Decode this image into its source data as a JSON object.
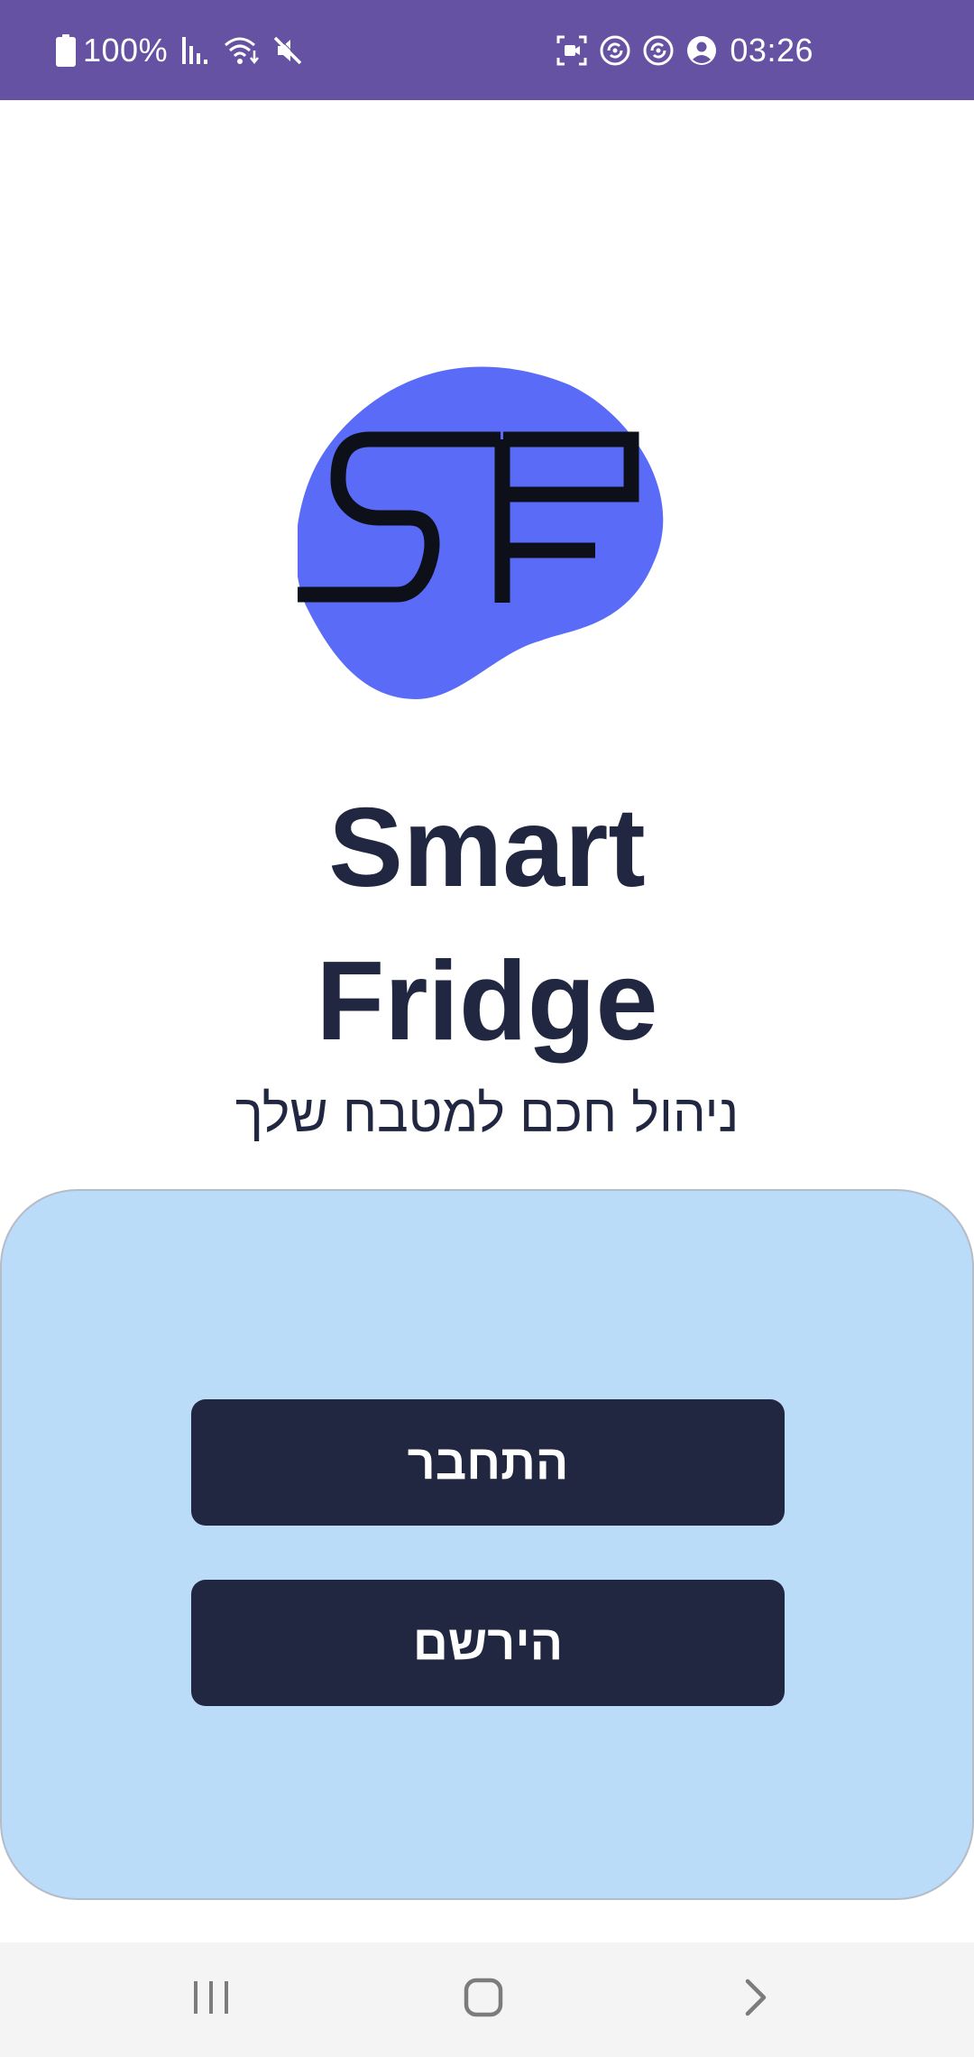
{
  "status_bar": {
    "battery": "100%",
    "time": "03:26",
    "background": "#6652a3",
    "icons_left": [
      "battery-icon",
      "signal-icon",
      "wifi-icon",
      "mute-icon"
    ],
    "icons_right": [
      "screen-record-icon",
      "sync-icon",
      "sync-icon",
      "account-icon"
    ]
  },
  "logo": {
    "text": "SF",
    "blob_color": "#5a6cf7"
  },
  "app": {
    "title_line1": "Smart",
    "title_line2": "Fridge",
    "subtitle": "ניהול חכם למטבח שלך",
    "text_color": "#222741"
  },
  "auth": {
    "card_color": "#bbdcf8",
    "login_label": "התחבר",
    "register_label": "הירשם",
    "button_color": "#222741"
  },
  "nav_bar": {
    "icons": [
      "recents-icon",
      "home-icon",
      "back-icon"
    ]
  }
}
